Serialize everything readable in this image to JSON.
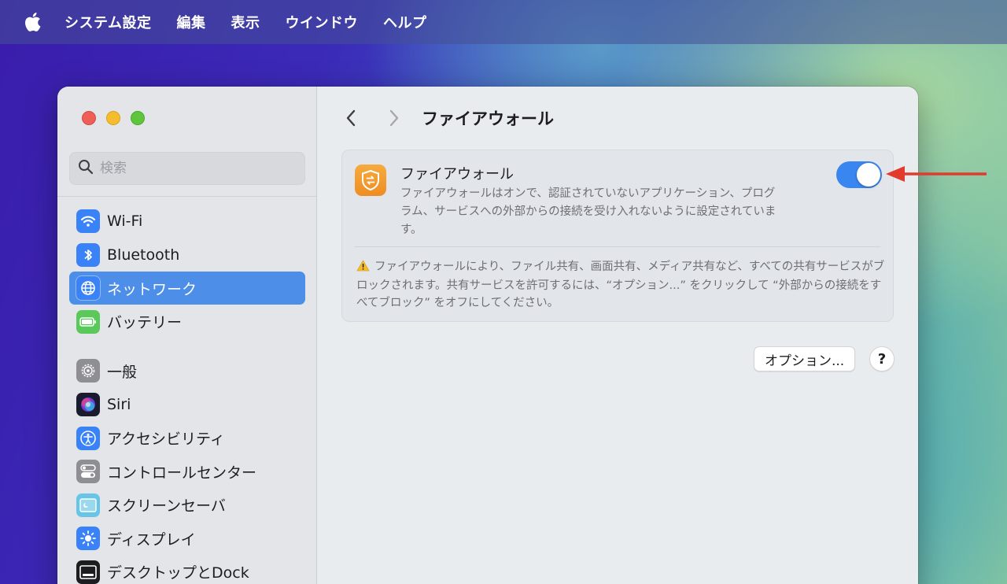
{
  "menubar": {
    "app_name": "システム設定",
    "items": [
      "編集",
      "表示",
      "ウインドウ",
      "ヘルプ"
    ]
  },
  "sidebar": {
    "search_placeholder": "検索",
    "items": [
      {
        "label": "Wi-Fi",
        "icon": "wifi-icon",
        "color": "#3a82f7"
      },
      {
        "label": "Bluetooth",
        "icon": "bluetooth-icon",
        "color": "#3a82f7"
      },
      {
        "label": "ネットワーク",
        "icon": "globe-icon",
        "color": "#3a82f7",
        "selected": true
      },
      {
        "label": "バッテリー",
        "icon": "battery-icon",
        "color": "#5ac85a"
      },
      {
        "label": "一般",
        "icon": "gear-icon",
        "color": "#8e8e93"
      },
      {
        "label": "Siri",
        "icon": "siri-icon",
        "color": "#1b1b2e"
      },
      {
        "label": "アクセシビリティ",
        "icon": "accessibility-icon",
        "color": "#3a82f7"
      },
      {
        "label": "コントロールセンター",
        "icon": "control-center-icon",
        "color": "#8e8e93"
      },
      {
        "label": "スクリーンセーバ",
        "icon": "screensaver-icon",
        "color": "#68c5e8"
      },
      {
        "label": "ディスプレイ",
        "icon": "display-icon",
        "color": "#3a82f7"
      },
      {
        "label": "デスクトップとDock",
        "icon": "dock-icon",
        "color": "#1d1d1f"
      }
    ]
  },
  "content": {
    "title": "ファイアウォール",
    "firewall": {
      "title": "ファイアウォール",
      "description": "ファイアウォールはオンで、認証されていないアプリケーション、プログラム、サービスへの外部からの接続を受け入れないように設定されています。",
      "enabled": true,
      "accent": "#3a86f0"
    },
    "warning": "ファイアウォールにより、ファイル共有、画面共有、メディア共有など、すべての共有サービスがブロックされます。共有サービスを許可するには、“オプション...” をクリックして “外部からの接続をすべてブロック” をオフにしてください。",
    "options_label": "オプション...",
    "help_label": "?"
  },
  "annotation": {
    "arrow_color": "#e23b2e"
  }
}
